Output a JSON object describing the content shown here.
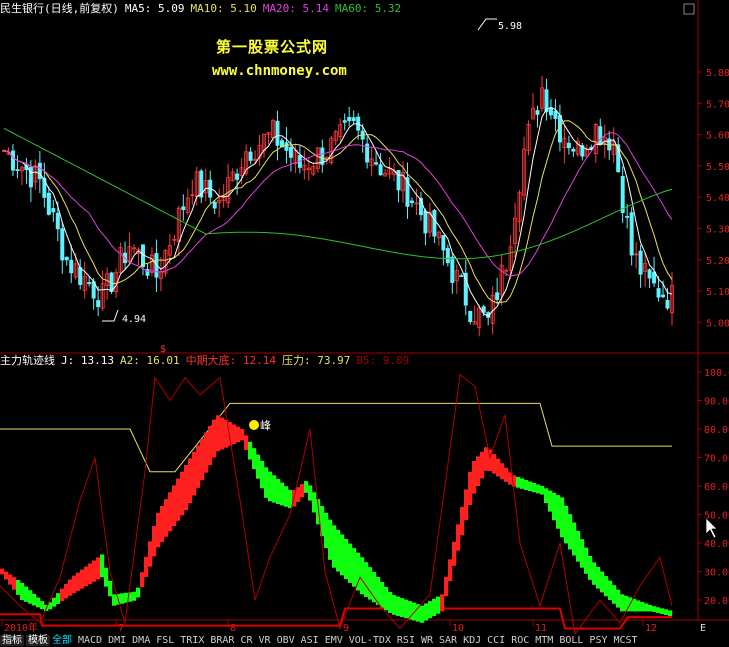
{
  "header_top": {
    "stock_name": "民生银行(日线,前复权)",
    "ma5": "MA5: 5.09",
    "ma10": "MA10: 5.10",
    "ma20": "MA20: 5.14",
    "ma60": "MA60: 5.32"
  },
  "header_bottom": {
    "indicator_name": "主力轨迹线",
    "j": "J: 13.13",
    "a2": "A2: 16.01",
    "mid_bottom": "中期大底: 12.14",
    "pressure": "压力: 73.97",
    "b5": "B5: 9.09"
  },
  "watermark": {
    "line1": "第一股票公式网",
    "line2": "www.chnmoney.com"
  },
  "annotations": {
    "high": "5.98",
    "low": "4.94",
    "peak_label": "峰",
    "dollar_mark": "$"
  },
  "price_axis": [
    "5.80",
    "5.70",
    "5.60",
    "5.50",
    "5.40",
    "5.30",
    "5.20",
    "5.10",
    "5.00"
  ],
  "indicator_axis": [
    "100.00",
    "90.00",
    "80.00",
    "70.00",
    "60.00",
    "50.00",
    "40.00",
    "30.00",
    "20.00"
  ],
  "time_axis": [
    "2010年",
    "7",
    "8",
    "9",
    "10",
    "11",
    "12"
  ],
  "corner_label": "E",
  "bottom_tabs": {
    "tab_indicator": "指标",
    "tab_template": "模板",
    "items": [
      "全部",
      "MACD",
      "DMI",
      "DMA",
      "FSL",
      "TRIX",
      "BRAR",
      "CR",
      "VR",
      "OBV",
      "ASI",
      "EMV",
      "VOL-TDX",
      "RSI",
      "WR",
      "SAR",
      "KDJ",
      "CCI",
      "ROC",
      "MTM",
      "BOLL",
      "PSY",
      "MCST"
    ]
  },
  "colors": {
    "up_candle": "#ff3a3a",
    "down_candle": "#5ef2ff",
    "ma5": "#ffffff",
    "ma10": "#e8e060",
    "ma20": "#e040e0",
    "ma60": "#30c030",
    "pressure_line": "#e8e060",
    "bottom_line": "#e00000",
    "fill_up": "#ff2020",
    "fill_down": "#10ff10",
    "frame": "#a00000",
    "axis_text": "#e02020"
  }
}
